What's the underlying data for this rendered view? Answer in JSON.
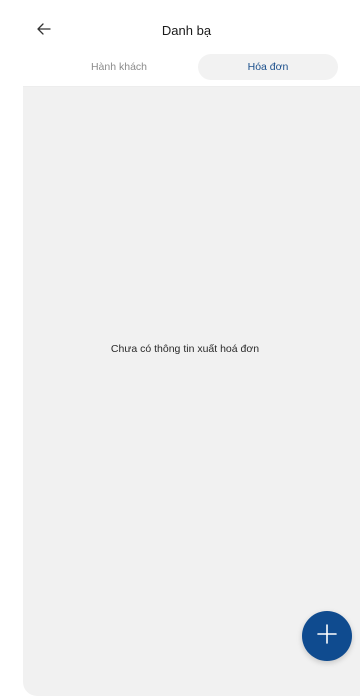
{
  "header": {
    "title": "Danh bạ",
    "back_icon": "arrow-left-icon"
  },
  "tabs": [
    {
      "label": "Hành khách",
      "active": false
    },
    {
      "label": "Hóa đơn",
      "active": true
    }
  ],
  "empty_state": {
    "message": "Chưa có thông tin xuất hoá đơn"
  },
  "fab": {
    "icon": "plus-icon"
  },
  "colors": {
    "accent": "#0f4b8f",
    "active_tab_text": "#1b4f8c",
    "inactive_tab_text": "#8c8c8c",
    "content_bg": "#f1f1f1"
  }
}
